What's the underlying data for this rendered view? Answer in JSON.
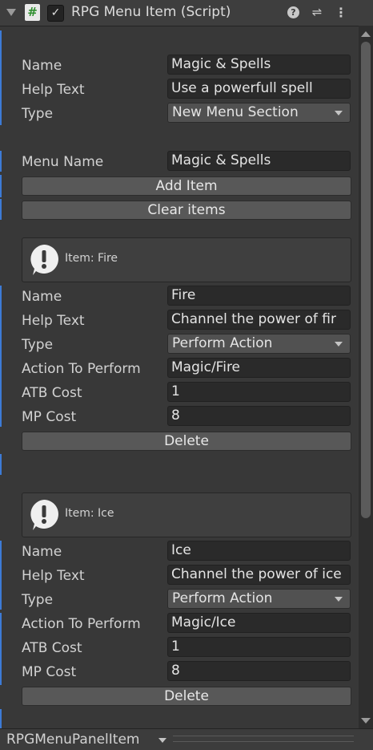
{
  "header": {
    "title": "RPG Menu Item (Script)",
    "script_icon": "hash-script-icon",
    "enabled": true
  },
  "section_header": {
    "name_label": "Name",
    "name_value": "Magic & Spells",
    "help_label": "Help Text",
    "help_value": "Use a powerfull spell",
    "type_label": "Type",
    "type_value": "New Menu Section",
    "menu_name_label": "Menu Name",
    "menu_name_value": "Magic & Spells",
    "add_item_label": "Add Item",
    "clear_items_label": "Clear items"
  },
  "items": [
    {
      "helpbox_text": "Item: Fire",
      "name_label": "Name",
      "name_value": "Fire",
      "help_label": "Help Text",
      "help_value": "Channel the power of fir",
      "type_label": "Type",
      "type_value": "Perform Action",
      "action_label": "Action To Perform",
      "action_value": "Magic/Fire",
      "atb_label": "ATB Cost",
      "atb_value": "1",
      "mp_label": "MP Cost",
      "mp_value": "8",
      "delete_label": "Delete"
    },
    {
      "helpbox_text": "Item: Ice",
      "name_label": "Name",
      "name_value": "Ice",
      "help_label": "Help Text",
      "help_value": "Channel the power of ice",
      "type_label": "Type",
      "type_value": "Perform Action",
      "action_label": "Action To Perform",
      "action_value": "Magic/Ice",
      "atb_label": "ATB Cost",
      "atb_value": "1",
      "mp_label": "MP Cost",
      "mp_value": "8",
      "delete_label": "Delete"
    }
  ],
  "footer": {
    "dropdown_value": "RPGMenuPanelItem"
  },
  "colors": {
    "background": "#383838",
    "accent_bar": "#3d7bd6",
    "field_bg": "#2a2a2a",
    "button_bg": "#585858"
  }
}
